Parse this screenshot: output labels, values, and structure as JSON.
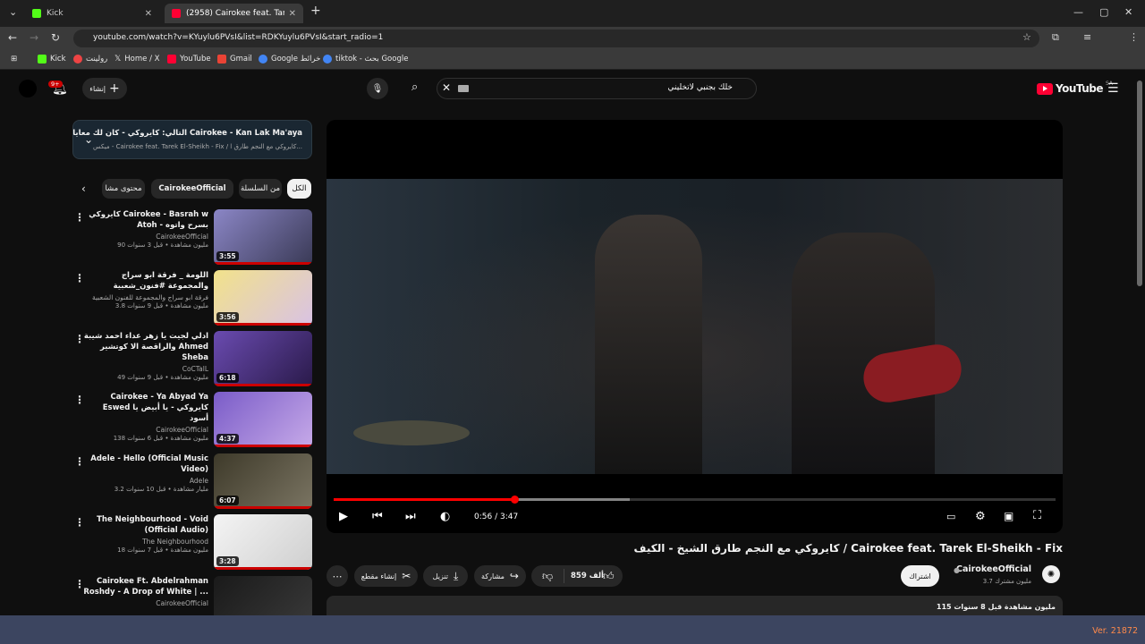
{
  "browser": {
    "tabs": [
      {
        "label": "Kick"
      },
      {
        "label": "(2958) Cairokee feat. Tarek El-S"
      }
    ],
    "url": "youtube.com/watch?v=KYuylu6PVsI&list=RDKYuylu6PVsI&start_radio=1",
    "bookmarks": [
      "Kick",
      "رولينت",
      "Home / X",
      "YouTube",
      "Gmail",
      "Google خرائط",
      "tiktok - بحث Google"
    ]
  },
  "header": {
    "logo": "YouTube",
    "region": "SA",
    "search_value": "خلك بجنبي لاتخليني",
    "create_label": "إنشاء",
    "notif_count": "9+"
  },
  "next_box": {
    "title": "التالي: كايروكي - كان لك معايا Cairokee - Kan Lak Ma'aya",
    "subtitle": "ميكس - Cairokee feat. Tarek El-Sheikh - Fix / كايروكي مع النجم طارق ا..."
  },
  "chips": [
    "الكل",
    "من السلسلة",
    "CairokeeOfficial",
    "محتوى مشا"
  ],
  "playlist": [
    {
      "title": "كايروكي Cairokee - Basrah w Atoh - بسرح واتوه",
      "channel": "CairokeeOfficial",
      "meta": "90 مليون مشاهدة • قبل 3 سنوات",
      "duration": "3:55",
      "colors": [
        "#8b86c6",
        "#3a3a56"
      ]
    },
    {
      "title": "اللومة _ فرقة ابو سراج والمجموعة #فنون_شعبية",
      "channel": "فرقة ابو سراج والمجموعة للفنون الشعبية",
      "meta": "3.8 مليون مشاهدة • قبل 9 سنوات",
      "duration": "3:56",
      "colors": [
        "#f2e28a",
        "#d9c2e4"
      ]
    },
    {
      "title": "ادلي لجيت يا زهر عداء احمد شيبة والراقصة الا كوتشير Ahmed Sheba",
      "channel": "CoCTalL",
      "meta": "49 مليون مشاهدة • قبل 9 سنوات",
      "duration": "6:18",
      "colors": [
        "#6a4bb0",
        "#2a1a4a"
      ]
    },
    {
      "title": "Cairokee - Ya Abyad Ya Eswed كايروكي - يا أبيض يا أسود",
      "channel": "CairokeeOfficial",
      "meta": "138 مليون مشاهدة • قبل 6 سنوات",
      "duration": "4:37",
      "colors": [
        "#7a5cc8",
        "#c6a9e8"
      ]
    },
    {
      "title": "Adele - Hello (Official Music Video)",
      "channel": "Adele",
      "meta": "3.2 مليار مشاهدة • قبل 10 سنوات",
      "duration": "6:07",
      "colors": [
        "#3e3a2a",
        "#7a7462"
      ]
    },
    {
      "title": "The Neighbourhood - Void (Official Audio)",
      "channel": "The Neighbourhood",
      "meta": "18 مليون مشاهدة • قبل 7 سنوات",
      "duration": "3:28",
      "colors": [
        "#f4f4f4",
        "#cfcfcf"
      ]
    },
    {
      "title": "Cairokee Ft. Abdelrahman Roshdy - A Drop of White | ...",
      "channel": "CairokeeOfficial",
      "meta": "",
      "duration": "",
      "colors": [
        "#1a1a1a",
        "#3a3a3a"
      ]
    }
  ],
  "player": {
    "time": "0:56 / 3:47",
    "progress": 0.25,
    "buffered": 0.41
  },
  "video": {
    "title": "كايروكي مع النجم طارق الشيخ - الكيف / Cairokee feat. Tarek El-Sheikh - Fix",
    "channel": "CairokeeOfficial",
    "subscribers": "3.7 مليون مشترك",
    "subscribe_label": "اشتراك",
    "likes": "859 ألف",
    "share": "مشاركة",
    "download": "تنزيل",
    "clip": "إنشاء مقطع",
    "views_meta": "115 مليون مشاهدة  قبل 8 سنوات"
  },
  "taskbar": {
    "version": "Ver. 21872"
  }
}
